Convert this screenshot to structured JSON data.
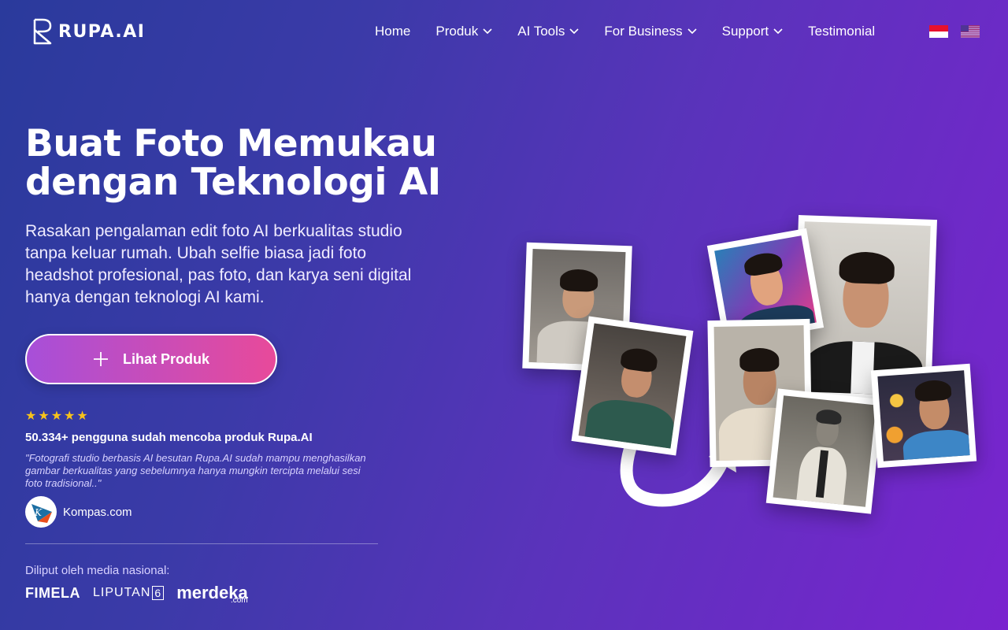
{
  "brand": {
    "name": "RUPA.AI"
  },
  "nav": {
    "items": [
      {
        "label": "Home",
        "dropdown": false
      },
      {
        "label": "Produk",
        "dropdown": true
      },
      {
        "label": "AI Tools",
        "dropdown": true
      },
      {
        "label": "For Business",
        "dropdown": true
      },
      {
        "label": "Support",
        "dropdown": true
      },
      {
        "label": "Testimonial",
        "dropdown": false
      }
    ],
    "languages": [
      "id",
      "en"
    ]
  },
  "hero": {
    "title_line1": "Buat Foto Memukau",
    "title_line2": "dengan Teknologi AI",
    "subtitle": "Rasakan pengalaman edit foto AI berkualitas studio tanpa keluar rumah. Ubah selfie biasa jadi foto headshot profesional, pas foto, dan karya seni digital hanya dengan teknologi AI kami.",
    "cta_label": "Lihat Produk",
    "rating": 5,
    "users_text": "50.334+ pengguna sudah mencoba produk Rupa.AI",
    "quote": "\"Fotografi studio berbasis AI besutan Rupa.AI sudah mampu menghasilkan gambar berkualitas yang sebelumnya hanya mungkin tercipta melalui sesi foto tradisional..\"",
    "quote_source": "Kompas.com"
  },
  "media": {
    "label": "Diliput oleh media nasional:",
    "outlets": [
      "FIMELA",
      "LIPUTAN",
      "6",
      ".COM",
      "merdeka",
      ".com"
    ]
  },
  "colors": {
    "accent_start": "#a74fd9",
    "accent_end": "#e84a9a",
    "star": "#f7c21b"
  }
}
